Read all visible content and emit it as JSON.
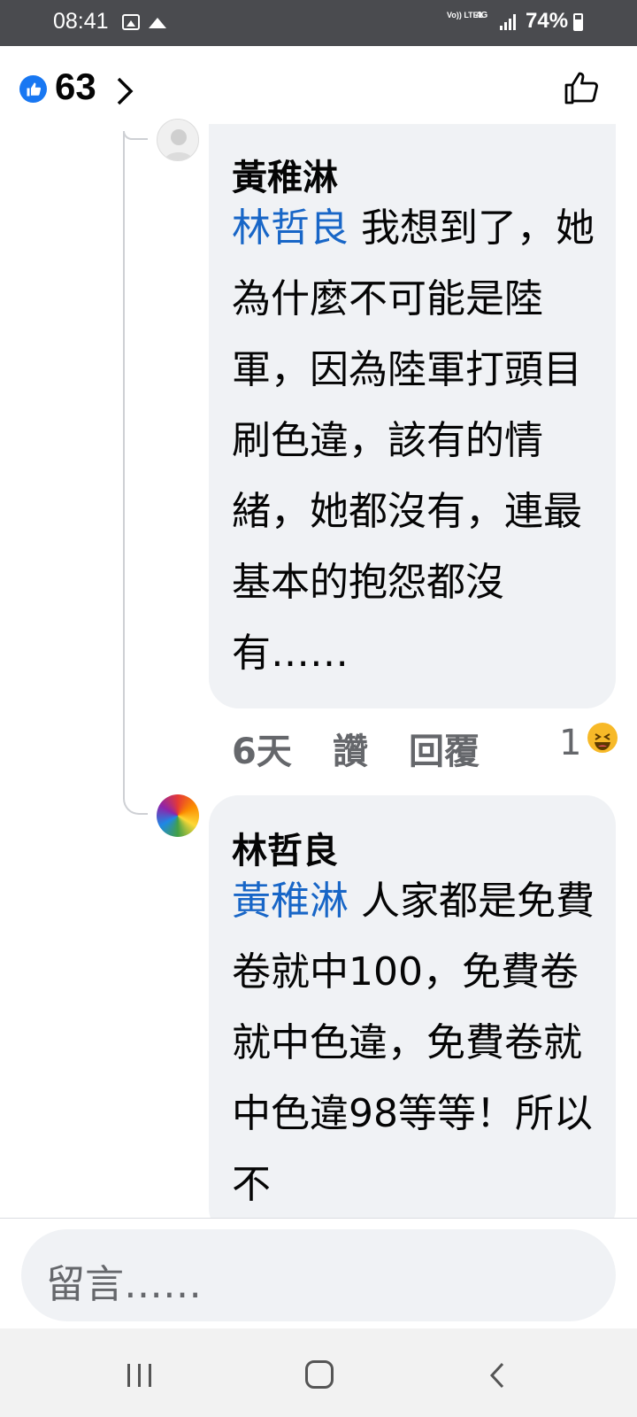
{
  "status_bar": {
    "time": "08:41",
    "volte": "Vo)) LTE1",
    "network": "4G",
    "battery": "74%"
  },
  "header": {
    "like_count": "63"
  },
  "comments": [
    {
      "author": "黃稚淋",
      "mention": "林哲良",
      "text": " 我想到了，她為什麼不可能是陸軍，因為陸軍打頭目刷色違，該有的情緒，她都沒有，連最基本的抱怨都沒有……",
      "time": "6天",
      "like_label": "讚",
      "reply_label": "回覆",
      "reaction_count": "1",
      "reaction_icon": "laughing-emoji-icon"
    },
    {
      "author": "林哲良",
      "mention": "黃稚淋",
      "text": " 人家都是免費卷就中100，免費卷就中色違，免費卷就中色違98等等！所以不"
    }
  ],
  "composer": {
    "placeholder": "留言……"
  },
  "colors": {
    "accent": "#1877f2",
    "mention": "#1866c7",
    "bubble": "#f0f2f5",
    "meta": "#65676b"
  }
}
